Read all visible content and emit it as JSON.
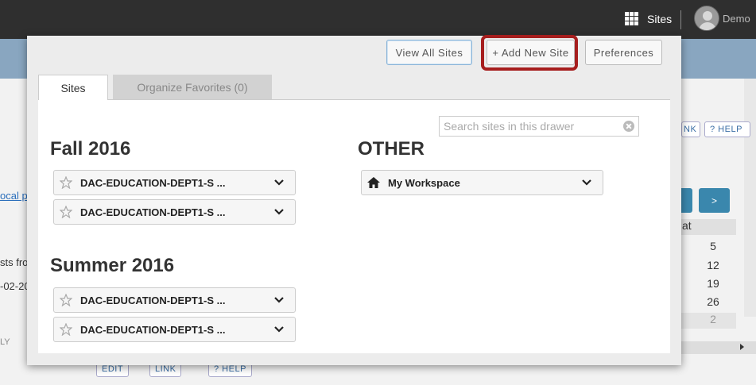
{
  "topbar": {
    "sites_label": "Sites",
    "user_name": "Demo"
  },
  "background": {
    "link_fragment": "ocal pr",
    "text_fragment_1": "sts fro",
    "text_fragment_2": "-02-20",
    "text_fragment_3": "LY",
    "button_fragment_link": "NK",
    "button_help": "? HELP",
    "bottom_edit": "EDIT",
    "bottom_link": "LINK",
    "bottom_help": "? HELP",
    "calendar": {
      "next_label": ">",
      "header": "at",
      "dates": [
        "5",
        "12",
        "19",
        "26"
      ],
      "last_date": "2"
    }
  },
  "drawer": {
    "buttons": {
      "view_all": "View All Sites",
      "add_new_site": "+ Add New Site",
      "preferences": "Preferences"
    },
    "tabs": {
      "sites": "Sites",
      "organize_favorites": "Organize Favorites (0)"
    },
    "search": {
      "placeholder": "Search sites in this drawer",
      "value": ""
    },
    "terms": [
      {
        "title": "Fall 2016",
        "sites": [
          "DAC-EDUCATION-DEPT1-S ...",
          "DAC-EDUCATION-DEPT1-S ..."
        ]
      },
      {
        "title": "Summer 2016",
        "sites": [
          "DAC-EDUCATION-DEPT1-S ...",
          "DAC-EDUCATION-DEPT1-S ..."
        ]
      }
    ],
    "other": {
      "title": "OTHER",
      "sites": [
        "My Workspace"
      ]
    }
  },
  "colors": {
    "topbar": "#2f2f2f",
    "highlight_ring": "#a61e1e",
    "calendar_nav": "#3a87ad",
    "page_band": "#89a6c0"
  }
}
